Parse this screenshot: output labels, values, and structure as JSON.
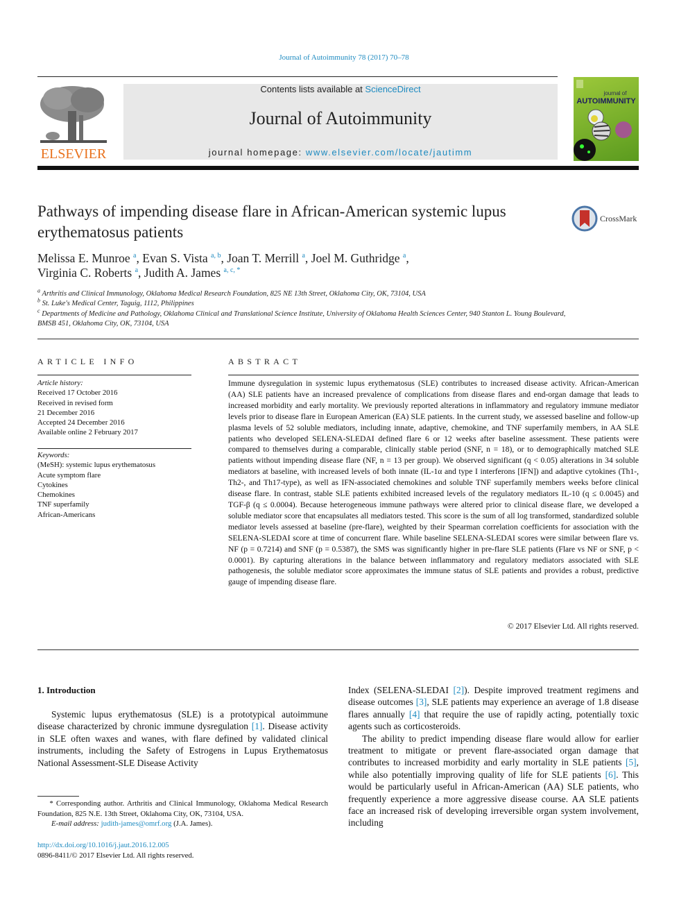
{
  "header": {
    "running_head": "Journal of Autoimmunity 78 (2017) 70–78",
    "contents_prefix": "Contents lists available at ",
    "contents_link": "ScienceDirect",
    "journal_title": "Journal of Autoimmunity",
    "homepage_prefix": "journal homepage: ",
    "homepage_link": "www.elsevier.com/locate/jautimm",
    "publisher_logo_text": "ELSEVIER",
    "cover": {
      "line1": "journal of",
      "line2": "AUTOIMMUNITY"
    },
    "crossmark_label": "CrossMark"
  },
  "article": {
    "title": "Pathways of impending disease flare in African-American systemic lupus erythematosus patients",
    "authors": [
      {
        "name": "Melissa E. Munroe",
        "aff": "a",
        "sep": ", "
      },
      {
        "name": "Evan S. Vista",
        "aff": "a, b",
        "sep": ", "
      },
      {
        "name": "Joan T. Merrill",
        "aff": "a",
        "sep": ", "
      },
      {
        "name": "Joel M. Guthridge",
        "aff": "a",
        "sep": ","
      },
      {
        "name": "Virginia C. Roberts",
        "aff": "a",
        "sep": ", "
      },
      {
        "name": "Judith A. James",
        "aff": "a, c, *",
        "sep": ""
      }
    ],
    "affiliations": [
      {
        "key": "a",
        "text": "Arthritis and Clinical Immunology, Oklahoma Medical Research Foundation, 825 NE 13th Street, Oklahoma City, OK, 73104, USA"
      },
      {
        "key": "b",
        "text": "St. Luke's Medical Center, Taguig, 1112, Philippines"
      },
      {
        "key": "c",
        "text": "Departments of Medicine and Pathology, Oklahoma Clinical and Translational Science Institute, University of Oklahoma Health Sciences Center, 940 Stanton L. Young Boulevard, BMSB 451, Oklahoma City, OK, 73104, USA"
      }
    ]
  },
  "article_info": {
    "heading": "ARTICLE INFO",
    "history_label": "Article history:",
    "history": [
      "Received 17 October 2016",
      "Received in revised form",
      "21 December 2016",
      "Accepted 24 December 2016",
      "Available online 2 February 2017"
    ],
    "keywords_label": "Keywords:",
    "keywords": [
      "(MeSH): systemic lupus erythematosus",
      "Acute symptom flare",
      "Cytokines",
      "Chemokines",
      "TNF superfamily",
      "African-Americans"
    ]
  },
  "abstract": {
    "heading": "ABSTRACT",
    "text": "Immune dysregulation in systemic lupus erythematosus (SLE) contributes to increased disease activity. African-American (AA) SLE patients have an increased prevalence of complications from disease flares and end-organ damage that leads to increased morbidity and early mortality. We previously reported alterations in inflammatory and regulatory immune mediator levels prior to disease flare in European American (EA) SLE patients. In the current study, we assessed baseline and follow-up plasma levels of 52 soluble mediators, including innate, adaptive, chemokine, and TNF superfamily members, in AA SLE patients who developed SELENA-SLEDAI defined flare 6 or 12 weeks after baseline assessment. These patients were compared to themselves during a comparable, clinically stable period (SNF, n = 18), or to demographically matched SLE patients without impending disease flare (NF, n = 13 per group). We observed significant (q < 0.05) alterations in 34 soluble mediators at baseline, with increased levels of both innate (IL-1α and type I interferons [IFN]) and adaptive cytokines (Th1-, Th2-, and Th17-type), as well as IFN-associated chemokines and soluble TNF superfamily members weeks before clinical disease flare. In contrast, stable SLE patients exhibited increased levels of the regulatory mediators IL-10 (q ≤ 0.0045) and TGF-β (q ≤ 0.0004). Because heterogeneous immune pathways were altered prior to clinical disease flare, we developed a soluble mediator score that encapsulates all mediators tested. This score is the sum of all log transformed, standardized soluble mediator levels assessed at baseline (pre-flare), weighted by their Spearman correlation coefficients for association with the SELENA-SLEDAI score at time of concurrent flare. While baseline SELENA-SLEDAI scores were similar between flare vs. NF (p = 0.7214) and SNF (p = 0.5387), the SMS was significantly higher in pre-flare SLE patients (Flare vs NF or SNF, p < 0.0001). By capturing alterations in the balance between inflammatory and regulatory mediators associated with SLE pathogenesis, the soluble mediator score approximates the immune status of SLE patients and provides a robust, predictive gauge of impending disease flare.",
    "copyright": "© 2017 Elsevier Ltd. All rights reserved."
  },
  "body": {
    "section_heading": "1.  Introduction",
    "left_paragraph": {
      "before_ref1": "Systemic lupus erythematosus (SLE) is a prototypical autoimmune disease characterized by chronic immune dysregulation ",
      "ref1": "[1]",
      "after_ref1": ". Disease activity in SLE often waxes and wanes, with flare defined by validated clinical instruments, including the Safety of Estrogens in Lupus Erythematosus National Assessment-SLE Disease Activity"
    },
    "right_para1": {
      "t1": "Index (SELENA-SLEDAI ",
      "r2": "[2]",
      "t2": "). Despite improved treatment regimens and disease outcomes ",
      "r3": "[3]",
      "t3": ", SLE patients may experience an average of 1.8 disease flares annually ",
      "r4": "[4]",
      "t4": " that require the use of rapidly acting, potentially toxic agents such as corticosteroids."
    },
    "right_para2": {
      "t1": "The ability to predict impending disease flare would allow for earlier treatment to mitigate or prevent flare-associated organ damage that contributes to increased morbidity and early mortality in SLE patients ",
      "r5": "[5]",
      "t2": ", while also potentially improving quality of life for SLE patients ",
      "r6": "[6]",
      "t3": ". This would be particularly useful in African-American (AA) SLE patients, who frequently experience a more aggressive disease course. AA SLE patients face an increased risk of developing irreversible organ system involvement, including"
    }
  },
  "footnote": {
    "corresponding": "* Corresponding author. Arthritis and Clinical Immunology, Oklahoma Medical Research Foundation, 825 N.E. 13th Street, Oklahoma City, OK, 73104, USA.",
    "email_label": "E-mail address: ",
    "email": "judith-james@omrf.org",
    "email_suffix": " (J.A. James).",
    "doi": "http://dx.doi.org/10.1016/j.jaut.2016.12.005",
    "issn_line": "0896-8411/© 2017 Elsevier Ltd. All rights reserved."
  },
  "colors": {
    "link": "#1d8ac0",
    "elsevier_orange": "#e9711c",
    "banner_gray": "#e8e8e8",
    "cover_green": "#8cc034"
  }
}
